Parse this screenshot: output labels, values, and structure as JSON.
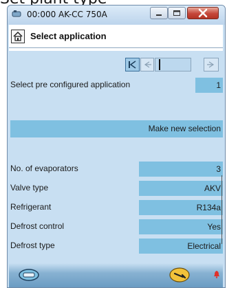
{
  "page_heading": "Set plant type",
  "window": {
    "title": "00:000 AK-CC 750A",
    "min_label": "–",
    "max_label": "☐",
    "close_label": "✕"
  },
  "screen": {
    "title": "Select application"
  },
  "nav": {
    "first": "|<",
    "prev": "<",
    "next": ">"
  },
  "preconfig": {
    "label": "Select pre configured application",
    "value": "1"
  },
  "new_selection": {
    "label": "Make new selection"
  },
  "rows": [
    {
      "label": "No. of evaporators",
      "value": "3"
    },
    {
      "label": "Valve type",
      "value": "AKV"
    },
    {
      "label": "Refrigerant",
      "value": "R134a"
    },
    {
      "label": "Defrost control",
      "value": "Yes"
    },
    {
      "label": "Defrost type",
      "value": "Electrical"
    }
  ],
  "colors": {
    "accent": "#7fc0e1",
    "panel": "#c8dff2",
    "alarm": "#e0302a"
  }
}
